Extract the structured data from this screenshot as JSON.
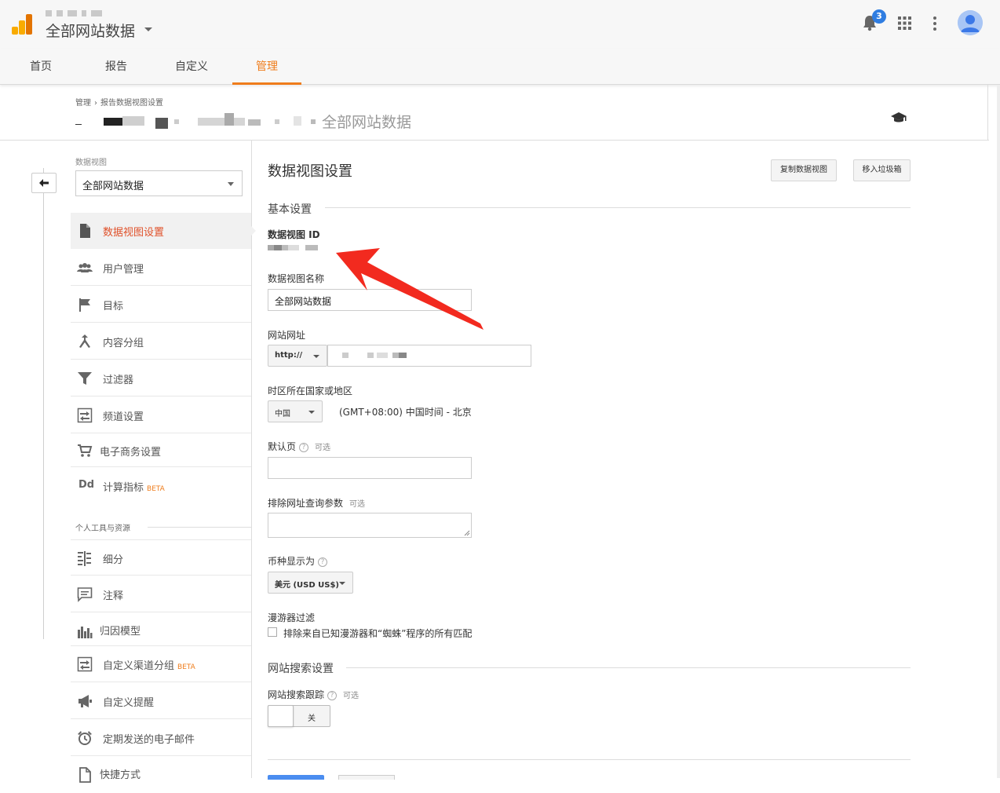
{
  "header": {
    "property_title": "全部网站数据",
    "notification_count": "3"
  },
  "nav": {
    "tabs": [
      {
        "label": "首页"
      },
      {
        "label": "报告"
      },
      {
        "label": "自定义"
      },
      {
        "label": "管理",
        "active": true
      }
    ]
  },
  "breadcrumb": {
    "items": [
      "管理",
      "报告数据视图设置"
    ],
    "separator": "›"
  },
  "subheader": {
    "view_name": "全部网站数据"
  },
  "sidebar": {
    "view_label": "数据视图",
    "view_select_value": "全部网站数据",
    "items": [
      {
        "label": "数据视图设置",
        "icon": "document-icon",
        "active": true
      },
      {
        "label": "用户管理",
        "icon": "users-icon"
      },
      {
        "label": "目标",
        "icon": "flag-icon"
      },
      {
        "label": "内容分组",
        "icon": "content-group-icon"
      },
      {
        "label": "过滤器",
        "icon": "filter-icon"
      },
      {
        "label": "频道设置",
        "icon": "channel-icon"
      },
      {
        "label": "电子商务设置",
        "icon": "cart-icon"
      },
      {
        "label": "计算指标",
        "icon": "dd-icon",
        "beta": "BETA"
      }
    ],
    "section_title": "个人工具与资源",
    "tools": [
      {
        "label": "细分",
        "icon": "segment-icon"
      },
      {
        "label": "注释",
        "icon": "annotation-icon"
      },
      {
        "label": "归因模型",
        "icon": "attribution-icon"
      },
      {
        "label": "自定义渠道分组",
        "icon": "custom-channel-icon",
        "beta": "BETA"
      },
      {
        "label": "自定义提醒",
        "icon": "megaphone-icon"
      },
      {
        "label": "定期发送的电子邮件",
        "icon": "alarm-icon"
      },
      {
        "label": "快捷方式",
        "icon": "shortcut-icon"
      }
    ]
  },
  "main": {
    "title": "数据视图设置",
    "copy_button": "复制数据视图",
    "trash_button": "移入垃圾箱",
    "basic_settings_title": "基本设置",
    "view_id_label": "数据视图 ID",
    "view_name_label": "数据视图名称",
    "view_name_value": "全部网站数据",
    "website_url_label": "网站网址",
    "protocol_value": "http://",
    "timezone_label": "时区所在国家或地区",
    "country_value": "中国",
    "timezone_value": "(GMT+08:00) 中国时间 - 北京",
    "default_page_label": "默认页",
    "optional_text": "可选",
    "help_glyph": "?",
    "exclude_params_label": "排除网址查询参数",
    "currency_label": "币种显示为",
    "currency_value": "美元 (USD US$)",
    "bot_filter_label": "漫游器过滤",
    "bot_filter_checkbox": "排除来自已知漫游器和“蜘蛛”程序的所有匹配",
    "site_search_title": "网站搜索设置",
    "site_search_tracking_label": "网站搜索跟踪",
    "toggle_value": "关"
  },
  "colors": {
    "accent_orange": "#ef7d1c",
    "active_red": "#e0512a",
    "annotation_arrow": "#f22a1f",
    "badge_blue": "#2f7de1"
  }
}
